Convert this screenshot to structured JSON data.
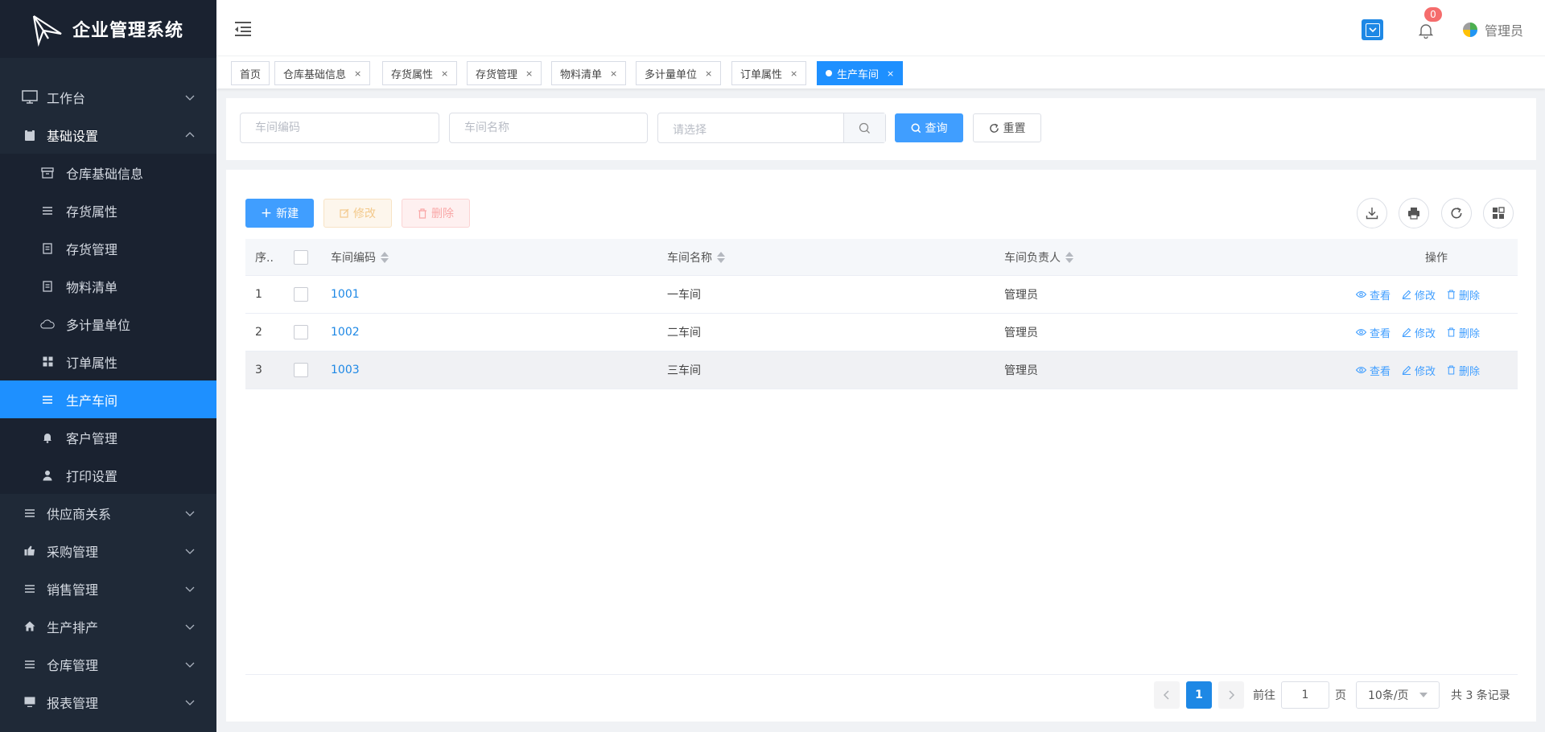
{
  "brand": {
    "title": "企业管理系统"
  },
  "sidebar": {
    "items": [
      {
        "label": "工作台",
        "icon": "monitor-icon",
        "level": 1,
        "expand": "down"
      },
      {
        "label": "基础设置",
        "icon": "clipboard-icon",
        "level": 1,
        "expand": "up"
      },
      {
        "label": "仓库基础信息",
        "icon": "archive-icon",
        "level": 2
      },
      {
        "label": "存货属性",
        "icon": "list-icon",
        "level": 2
      },
      {
        "label": "存货管理",
        "icon": "document-icon",
        "level": 2
      },
      {
        "label": "物料清单",
        "icon": "document-icon",
        "level": 2
      },
      {
        "label": "多计量单位",
        "icon": "cloud-icon",
        "level": 2
      },
      {
        "label": "订单属性",
        "icon": "grid-icon",
        "level": 2
      },
      {
        "label": "生产车间",
        "icon": "list-icon",
        "level": 2,
        "active": true
      },
      {
        "label": "客户管理",
        "icon": "bell-icon",
        "level": 2
      },
      {
        "label": "打印设置",
        "icon": "user-icon",
        "level": 2
      },
      {
        "label": "供应商关系",
        "icon": "list-icon",
        "level": 1,
        "expand": "down"
      },
      {
        "label": "采购管理",
        "icon": "thumb-icon",
        "level": 1,
        "expand": "down"
      },
      {
        "label": "销售管理",
        "icon": "list-icon",
        "level": 1,
        "expand": "down"
      },
      {
        "label": "生产排产",
        "icon": "home-icon",
        "level": 1,
        "expand": "down"
      },
      {
        "label": "仓库管理",
        "icon": "list-icon",
        "level": 1,
        "expand": "down"
      },
      {
        "label": "报表管理",
        "icon": "screen-icon",
        "level": 1,
        "expand": "down"
      }
    ]
  },
  "header": {
    "notification_count": "0",
    "user_name": "管理员"
  },
  "tabs": [
    {
      "label": "首页",
      "closable": false
    },
    {
      "label": "仓库基础信息",
      "closable": true
    },
    {
      "label": "存货属性",
      "closable": true
    },
    {
      "label": "存货管理",
      "closable": true
    },
    {
      "label": "物料清单",
      "closable": true
    },
    {
      "label": "多计量单位",
      "closable": true
    },
    {
      "label": "订单属性",
      "closable": true
    },
    {
      "label": "生产车间",
      "closable": true,
      "active": true
    }
  ],
  "search": {
    "code_placeholder": "车间编码",
    "name_placeholder": "车间名称",
    "select_placeholder": "请选择",
    "query_label": "查询",
    "reset_label": "重置"
  },
  "toolbar": {
    "new_label": "新建",
    "edit_label": "修改",
    "delete_label": "删除"
  },
  "table": {
    "columns": {
      "index": "序..",
      "code": "车间编码",
      "name": "车间名称",
      "owner": "车间负责人",
      "ops": "操作"
    },
    "rows": [
      {
        "index": "1",
        "code": "1001",
        "name": "一车间",
        "owner": "管理员"
      },
      {
        "index": "2",
        "code": "1002",
        "name": "二车间",
        "owner": "管理员"
      },
      {
        "index": "3",
        "code": "1003",
        "name": "三车间",
        "owner": "管理员"
      }
    ],
    "row_actions": {
      "view": "查看",
      "edit": "修改",
      "delete": "删除"
    }
  },
  "pagination": {
    "current_page": "1",
    "goto_label": "前往",
    "goto_value": "1",
    "page_suffix": "页",
    "page_size": "10条/页",
    "total": "共 3 条记录"
  },
  "colors": {
    "primary": "#409eff",
    "sidebar_bg": "#1f2937",
    "active_menu": "#1e90ff",
    "badge": "#f56c6c"
  }
}
